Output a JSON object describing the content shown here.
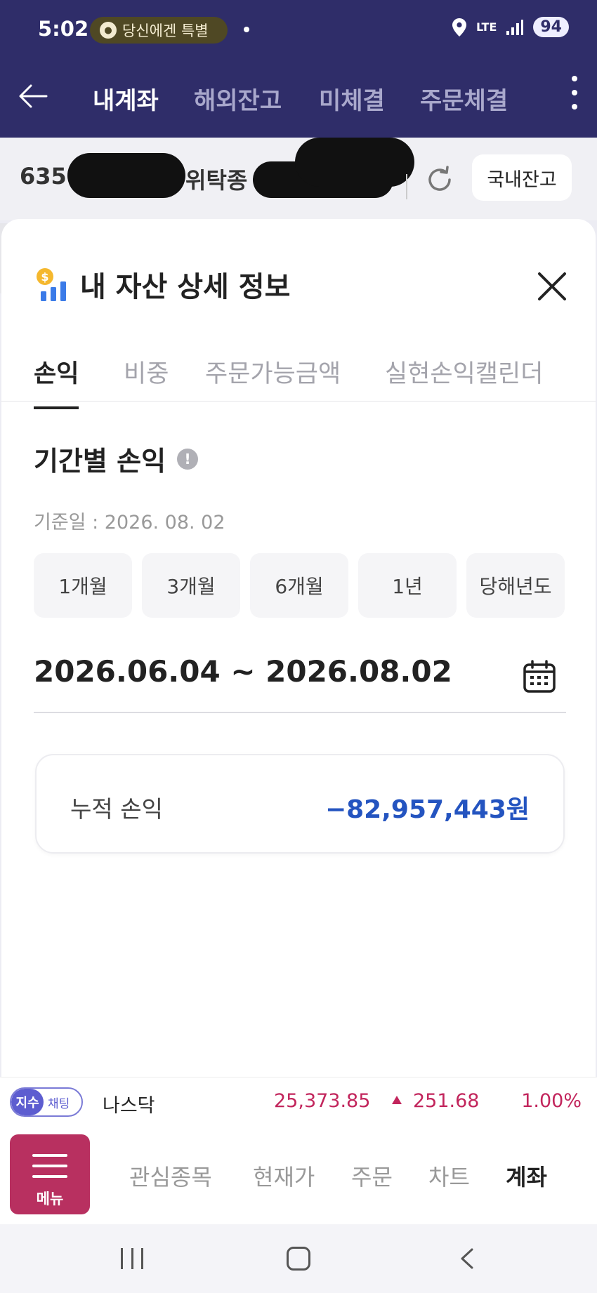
{
  "status_bar": {
    "time": "5:02",
    "notification_text": "당신에겐 특별",
    "network": "LTE",
    "battery": "94"
  },
  "header": {
    "tabs": [
      {
        "label": "내계좌",
        "active": true
      },
      {
        "label": "해외잔고",
        "active": false
      },
      {
        "label": "미체결",
        "active": false
      },
      {
        "label": "주문체결",
        "active": false
      }
    ]
  },
  "account": {
    "number_visible": "635",
    "type_visible": "위탁종",
    "domestic_button": "국내잔고"
  },
  "sheet": {
    "title": "내 자산 상세 정보",
    "tabs": [
      {
        "label": "손익",
        "active": true
      },
      {
        "label": "비중",
        "active": false
      },
      {
        "label": "주문가능금액",
        "active": false
      },
      {
        "label": "실현손익캘린더",
        "active": false
      }
    ],
    "section_title": "기간별 손익",
    "base_date": "기준일 : 2026. 08. 02",
    "periods": [
      "1개월",
      "3개월",
      "6개월",
      "1년",
      "당해년도"
    ],
    "range": "2026.06.04 ~ 2026.08.02",
    "cumulative": {
      "label": "누적 손익",
      "value": "−82,957,443원"
    }
  },
  "ticker": {
    "badge_a": "지수",
    "badge_b": "채팅",
    "name": "나스닥",
    "value": "25,373.85",
    "change": "251.68",
    "percent": "1.00%"
  },
  "bottom_nav": {
    "menu_label": "메뉴",
    "items": [
      {
        "label": "관심종목",
        "active": false
      },
      {
        "label": "현재가",
        "active": false
      },
      {
        "label": "주문",
        "active": false
      },
      {
        "label": "차트",
        "active": false
      },
      {
        "label": "계좌",
        "active": true
      }
    ]
  },
  "colors": {
    "header_bg": "#2f2d69",
    "loss_blue": "#2454c0",
    "rise_red": "#c2255c",
    "menu_bg": "#b83060"
  }
}
